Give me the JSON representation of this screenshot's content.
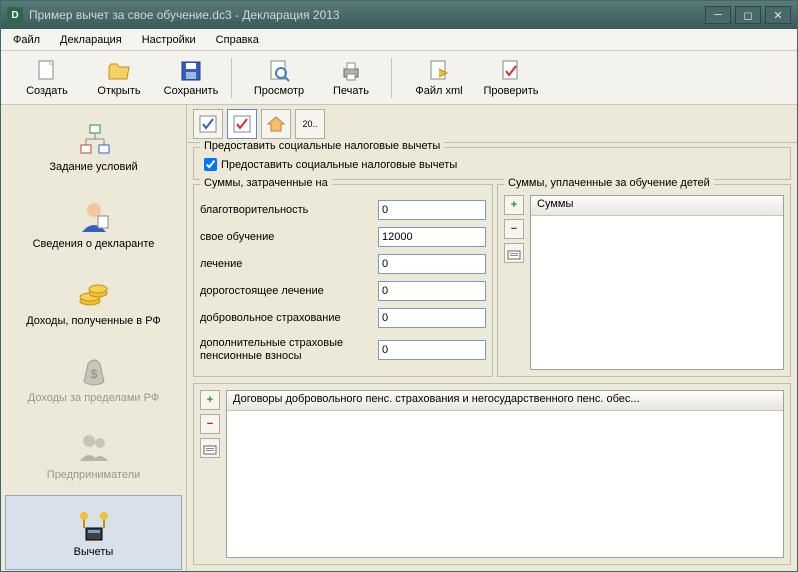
{
  "title": "Пример вычет за свое обучение.dc3 - Декларация 2013",
  "menu": {
    "file": "Файл",
    "declaration": "Декларация",
    "settings": "Настройки",
    "help": "Справка"
  },
  "toolbar": {
    "create": "Создать",
    "open": "Открыть",
    "save": "Сохранить",
    "preview": "Просмотр",
    "print": "Печать",
    "xml": "Файл xml",
    "check": "Проверить"
  },
  "sidebar": {
    "conditions": "Задание условий",
    "declarant": "Сведения о декларанте",
    "income_rf": "Доходы, полученные в РФ",
    "income_out": "Доходы за пределами РФ",
    "entrepreneurs": "Предприниматели",
    "deductions": "Вычеты"
  },
  "page_icons": {
    "twenty": "20.."
  },
  "group": {
    "title": "Предоставить социальные налоговые вычеты",
    "checkbox_label": "Предоставить социальные налоговые вычеты"
  },
  "left": {
    "legend": "Суммы, затраченные на",
    "charity": "благотворительность",
    "own_edu": "свое обучение",
    "treatment": "лечение",
    "exp_treatment": "дорогостоящее лечение",
    "insurance": "добровольное страхование",
    "pension": "дополнительные страховые пенсионные взносы"
  },
  "values": {
    "charity": "0",
    "own_edu": "12000",
    "treatment": "0",
    "exp_treatment": "0",
    "insurance": "0",
    "pension": "0"
  },
  "right": {
    "legend": "Суммы, уплаченные за обучение детей",
    "header": "Суммы"
  },
  "bottom": {
    "header": "Договоры добровольного пенс. страхования и негосударственного пенс. обес..."
  }
}
